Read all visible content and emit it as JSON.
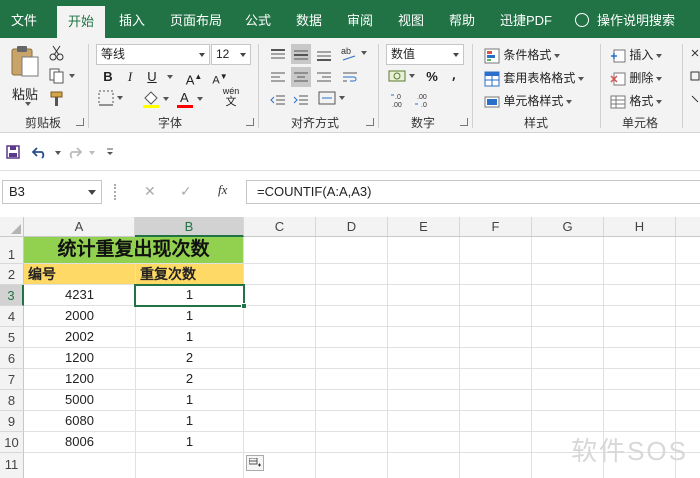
{
  "tabs": [
    "文件",
    "开始",
    "插入",
    "页面布局",
    "公式",
    "数据",
    "审阅",
    "视图",
    "帮助",
    "迅捷PDF"
  ],
  "active_tab": "开始",
  "tell_me": "操作说明搜索",
  "ribbon": {
    "clipboard": {
      "paste": "粘贴",
      "label": "剪贴板"
    },
    "font": {
      "name": "等线",
      "size": "12",
      "bold": "B",
      "italic": "I",
      "underline": "U",
      "grow": "A",
      "shrink": "A",
      "phonetic_top": "wén",
      "phonetic_bottom": "文",
      "label": "字体"
    },
    "alignment": {
      "label": "对齐方式"
    },
    "number": {
      "format": "数值",
      "percent": "%",
      "comma": "⸴",
      "label": "数字"
    },
    "styles": {
      "conditional": "条件格式",
      "table": "套用表格格式",
      "cell": "单元格样式",
      "label": "样式"
    },
    "cells": {
      "insert": "插入",
      "delete": "删除",
      "format": "格式",
      "label": "单元格"
    }
  },
  "formula_bar": {
    "name_box": "B3",
    "cancel": "✕",
    "enter": "✓",
    "fx": "fx",
    "formula": "=COUNTIF(A:A,A3)"
  },
  "columns": [
    "A",
    "B",
    "C",
    "D",
    "E",
    "F",
    "G",
    "H"
  ],
  "rows": [
    "1",
    "2",
    "3",
    "4",
    "5",
    "6",
    "7",
    "8",
    "9",
    "10",
    "11"
  ],
  "sheet": {
    "title": "统计重复出现次数",
    "header_a": "编号",
    "header_b": "重复次数",
    "data": [
      [
        "4231",
        "1"
      ],
      [
        "2000",
        "1"
      ],
      [
        "2002",
        "1"
      ],
      [
        "1200",
        "2"
      ],
      [
        "1200",
        "2"
      ],
      [
        "5000",
        "1"
      ],
      [
        "6080",
        "1"
      ],
      [
        "8006",
        "1"
      ]
    ]
  },
  "watermark": "软件SOS",
  "colors": {
    "brand": "#217346",
    "title_fill": "#92d050",
    "header_fill": "#ffd966"
  }
}
